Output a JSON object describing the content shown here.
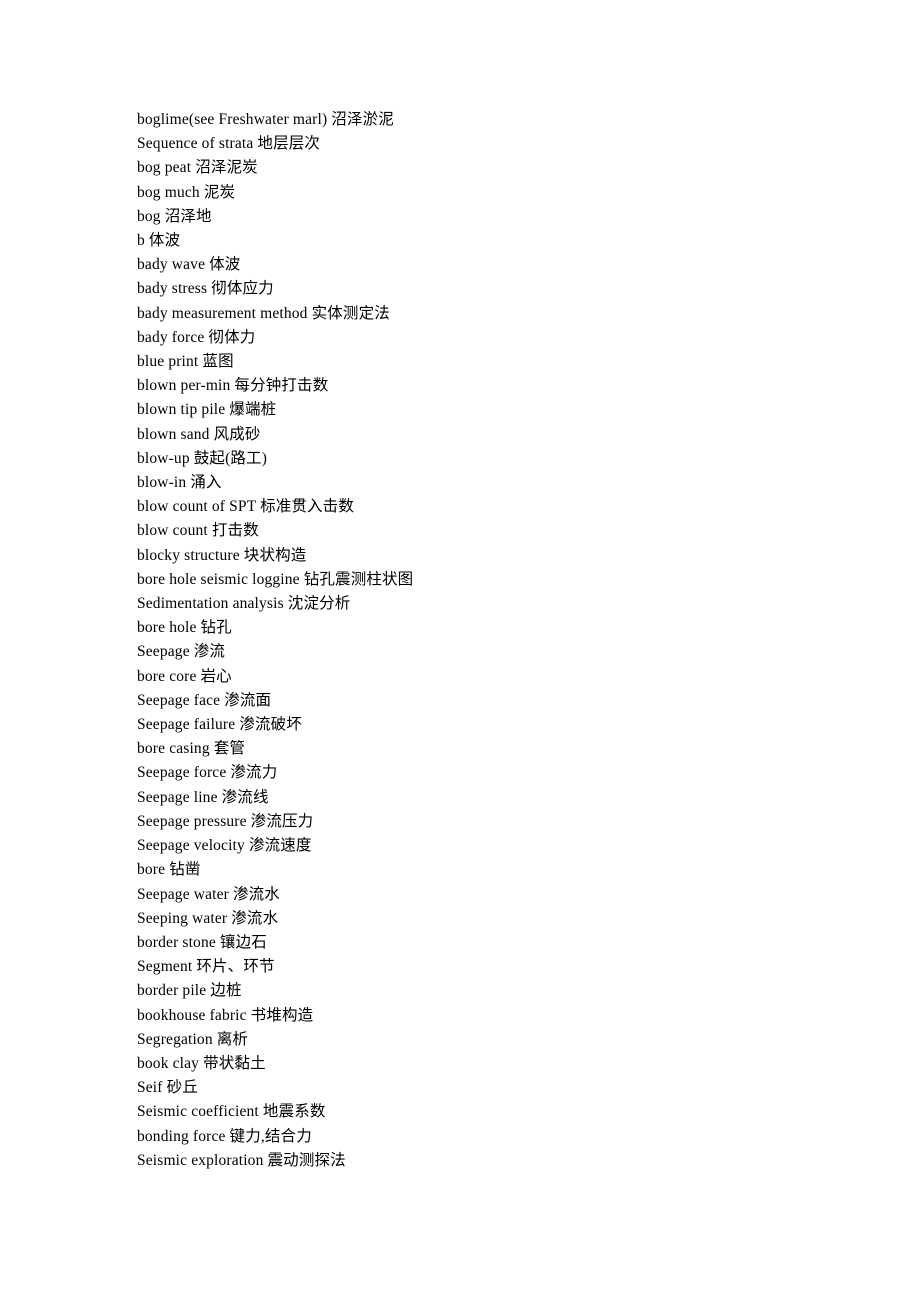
{
  "document": {
    "page_background": "#ffffff",
    "text_color": "#000000",
    "entries": [
      "boglime(see Freshwater marl) 沼泽淤泥",
      "Sequence of strata 地层层次",
      "bog peat 沼泽泥炭",
      "bog much 泥炭",
      "bog 沼泽地",
      "b 体波",
      "bady wave 体波",
      "bady stress 彻体应力",
      "bady measurement method 实体测定法",
      "bady force 彻体力",
      "blue print 蓝图",
      "blown per-min 每分钟打击数",
      "blown tip pile 爆端桩",
      "blown sand 风成砂",
      "blow-up 鼓起(路工)",
      "blow-in 涌入",
      "blow count of SPT 标准贯入击数",
      "blow count 打击数",
      "blocky structure 块状构造",
      "bore hole seismic loggine 钻孔震测柱状图",
      "Sedimentation analysis 沈淀分析",
      "bore hole 钻孔",
      "Seepage 渗流",
      "bore core 岩心",
      "Seepage face 渗流面",
      "Seepage failure 渗流破坏",
      "bore casing 套管",
      "Seepage force 渗流力",
      "Seepage line 渗流线",
      "Seepage pressure 渗流压力",
      "Seepage velocity 渗流速度",
      "bore 钻凿",
      "Seepage water 渗流水",
      "Seeping water 渗流水",
      "border stone 镶边石",
      "Segment 环片、环节",
      "border pile 边桩",
      "bookhouse fabric 书堆构造",
      "Segregation 离析",
      "book clay 带状黏土",
      "Seif 砂丘",
      "Seismic coefficient 地震系数",
      "bonding force 键力,结合力",
      "Seismic exploration 震动测探法"
    ]
  }
}
